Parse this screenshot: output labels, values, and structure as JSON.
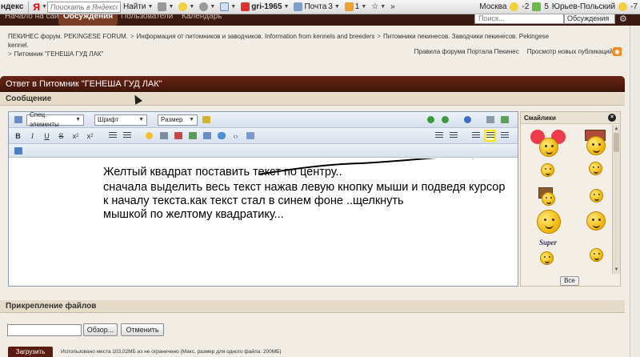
{
  "browser": {
    "brand_fragment": "ндекс",
    "yandex_letter": "Я",
    "search_placeholder": "Поискать в Яндексе",
    "find_label": "Найти",
    "username": "gri-1965",
    "mail_label": "Почта",
    "mail_count": "3",
    "notif_count": "1",
    "city": "Москва",
    "temp1": "-2",
    "weather_count": "5",
    "city2": "Юрьев-Польский",
    "temp2": "-7"
  },
  "nav": {
    "tabs": [
      {
        "label": "Начало на сайт"
      },
      {
        "label": "Обсуждения"
      },
      {
        "label": "Пользователи"
      },
      {
        "label": "Календарь"
      }
    ],
    "search_placeholder": "Поиск...",
    "search_scope": "Обсуждения"
  },
  "breadcrumb": {
    "items": [
      "ПЕКИНЕС форум. PEKINGESE FORUM.",
      "Информация от питомников и заводчиков. Information from kennels and breeders",
      "Питомники пекинесов. Заводчики пекинесов. Pekingese kennel.",
      "Питомник \"ГЕНЕША ГУД ЛАК\""
    ]
  },
  "top_links": {
    "rules": "Правила форума Портала Пекинес",
    "new_posts": "Просмотр новых публикаций"
  },
  "reply": {
    "title": "Ответ в Питомник \"ГЕНЕША ГУД ЛАК\"",
    "message_section": "Сообщение"
  },
  "editor": {
    "special_elements": "Спец. элементы",
    "font": "Шрифт",
    "size": "Размер",
    "bold": "B",
    "italic": "I",
    "underline": "U",
    "strike": "S",
    "subscript": "x",
    "superscript": "x",
    "note_lines": [
      "Желтый квадрат поставить текст по центру..",
      "сначала выделить весь текст нажав левую кнопку мыши и подведя курсор",
      "к началу текста.как текст стал в синем фоне ..щелкнуть",
      "мышкой по желтому квадратику..."
    ]
  },
  "smilies": {
    "title": "Смайлики",
    "close": "×",
    "super_label": "Super",
    "all_button": "Все"
  },
  "attachments": {
    "section": "Прикрепление файлов",
    "browse": "Обзор...",
    "cancel": "Отменить",
    "upload": "Загрузить",
    "usage": "Использовано места 103,02МБ из не ограничено (Макс. размер для одного файла: 200МБ)"
  },
  "colors": {
    "header_brown": "#5a1c10",
    "highlight_yellow": "#ffe600"
  },
  "icons": [
    "search-icon",
    "mail-icon",
    "star-icon",
    "gear-icon",
    "rss-icon",
    "close-icon"
  ]
}
